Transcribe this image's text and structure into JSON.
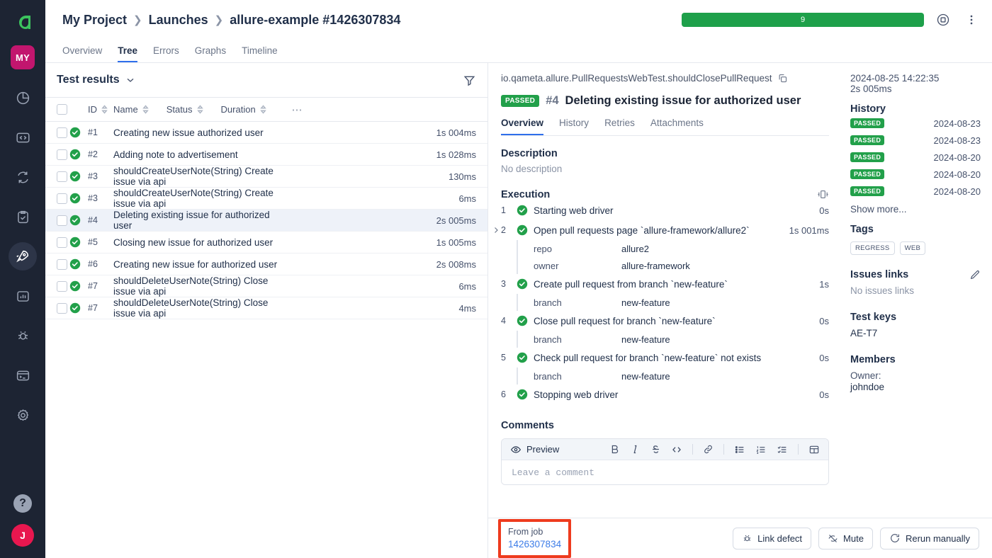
{
  "rail": {
    "logo": "allure-logo",
    "project_badge": "MY",
    "items": [
      {
        "icon": "pie-chart-icon",
        "name": "dashboards",
        "active": false
      },
      {
        "icon": "code-icon",
        "name": "code",
        "active": false
      },
      {
        "icon": "sync-icon",
        "name": "sync",
        "active": false
      },
      {
        "icon": "clipboard-check-icon",
        "name": "test-plan",
        "active": false
      },
      {
        "icon": "rocket-icon",
        "name": "launches",
        "active": true
      },
      {
        "icon": "bar-chart-icon",
        "name": "analytics",
        "active": false
      },
      {
        "icon": "bug-icon",
        "name": "defects",
        "active": false
      },
      {
        "icon": "terminal-icon",
        "name": "console",
        "active": false
      },
      {
        "icon": "gear-icon",
        "name": "settings",
        "active": false
      }
    ],
    "help": "?",
    "avatar": "J"
  },
  "header": {
    "breadcrumb": [
      "My Project",
      "Launches",
      "allure-example #1426307834"
    ],
    "progress_value": "9",
    "stop_icon": "stop-circle-icon",
    "menu_icon": "kebab-menu-icon"
  },
  "tabs": [
    {
      "label": "Overview",
      "active": false
    },
    {
      "label": "Tree",
      "active": true
    },
    {
      "label": "Errors",
      "active": false
    },
    {
      "label": "Graphs",
      "active": false
    },
    {
      "label": "Timeline",
      "active": false
    }
  ],
  "left_pane": {
    "title": "Test results",
    "filter_icon": "filter-icon",
    "columns": [
      "ID",
      "Name",
      "Status",
      "Duration"
    ],
    "more_icon": "ellipsis-icon",
    "rows": [
      {
        "id": "#1",
        "name": "Creating new issue authorized user",
        "status": "passed",
        "duration": "1s 004ms",
        "selected": false
      },
      {
        "id": "#2",
        "name": "Adding note to advertisement",
        "status": "passed",
        "duration": "1s 028ms",
        "selected": false
      },
      {
        "id": "#3",
        "name": "shouldCreateUserNote(String) Create issue via api",
        "status": "passed",
        "duration": "130ms",
        "selected": false
      },
      {
        "id": "#3",
        "name": "shouldCreateUserNote(String) Create issue via api",
        "status": "passed",
        "duration": "6ms",
        "selected": false
      },
      {
        "id": "#4",
        "name": "Deleting existing issue for authorized user",
        "status": "passed",
        "duration": "2s 005ms",
        "selected": true
      },
      {
        "id": "#5",
        "name": "Closing new issue for authorized user",
        "status": "passed",
        "duration": "1s 005ms",
        "selected": false
      },
      {
        "id": "#6",
        "name": "Creating new issue for authorized user",
        "status": "passed",
        "duration": "2s 008ms",
        "selected": false
      },
      {
        "id": "#7",
        "name": "shouldDeleteUserNote(String) Close issue via api",
        "status": "passed",
        "duration": "6ms",
        "selected": false
      },
      {
        "id": "#7",
        "name": "shouldDeleteUserNote(String) Close issue via api",
        "status": "passed",
        "duration": "4ms",
        "selected": false
      }
    ]
  },
  "detail": {
    "fqn": "io.qameta.allure.PullRequestsWebTest.shouldClosePullRequest",
    "copy_icon": "copy-icon",
    "status_badge": "PASSED",
    "test_number": "#4",
    "test_name": "Deleting existing issue for authorized user",
    "tabs": [
      {
        "label": "Overview",
        "active": true
      },
      {
        "label": "History",
        "active": false
      },
      {
        "label": "Retries",
        "active": false
      },
      {
        "label": "Attachments",
        "active": false
      }
    ],
    "description_heading": "Description",
    "description_value": "No description",
    "execution_heading": "Execution",
    "execution_icon": "expand-all-icon",
    "steps": [
      {
        "n": "1",
        "text": "Starting web driver",
        "duration": "0s",
        "expandable": false,
        "params": []
      },
      {
        "n": "2",
        "text": "Open pull requests page `allure-framework/allure2`",
        "duration": "1s 001ms",
        "expandable": true,
        "params": [
          {
            "k": "repo",
            "v": "allure2"
          },
          {
            "k": "owner",
            "v": "allure-framework"
          }
        ]
      },
      {
        "n": "3",
        "text": "Create pull request from branch `new-feature`",
        "duration": "1s",
        "expandable": false,
        "params": [
          {
            "k": "branch",
            "v": "new-feature"
          }
        ]
      },
      {
        "n": "4",
        "text": "Close pull request for branch `new-feature`",
        "duration": "0s",
        "expandable": false,
        "params": [
          {
            "k": "branch",
            "v": "new-feature"
          }
        ]
      },
      {
        "n": "5",
        "text": "Check pull request for branch `new-feature` not exists",
        "duration": "0s",
        "expandable": false,
        "params": [
          {
            "k": "branch",
            "v": "new-feature"
          }
        ]
      },
      {
        "n": "6",
        "text": "Stopping web driver",
        "duration": "0s",
        "expandable": false,
        "params": []
      }
    ],
    "comments_heading": "Comments",
    "editor": {
      "preview_label": "Preview",
      "preview_icon": "eye-icon",
      "placeholder": "Leave a comment",
      "tools": [
        "bold-icon",
        "italic-icon",
        "strikethrough-icon",
        "code-icon",
        "link-icon",
        "bulleted-list-icon",
        "numbered-list-icon",
        "checklist-icon",
        "table-icon"
      ]
    }
  },
  "meta": {
    "timestamp": "2024-08-25 14:22:35",
    "duration": "2s 005ms",
    "history_heading": "History",
    "history": [
      {
        "status": "PASSED",
        "date": "2024-08-23"
      },
      {
        "status": "PASSED",
        "date": "2024-08-23"
      },
      {
        "status": "PASSED",
        "date": "2024-08-20"
      },
      {
        "status": "PASSED",
        "date": "2024-08-20"
      },
      {
        "status": "PASSED",
        "date": "2024-08-20"
      }
    ],
    "show_more": "Show more...",
    "tags_heading": "Tags",
    "tags": [
      "REGRESS",
      "WEB"
    ],
    "issues_heading": "Issues links",
    "issues_edit_icon": "pencil-icon",
    "issues_value": "No issues links",
    "testkeys_heading": "Test keys",
    "testkeys_value": "AE-T7",
    "members_heading": "Members",
    "members_role": "Owner:",
    "members_value": "johndoe"
  },
  "actionbar": {
    "from_job_label": "From job",
    "from_job_value": "1426307834",
    "buttons": [
      {
        "label": "Link defect",
        "icon": "bug-icon"
      },
      {
        "label": "Mute",
        "icon": "eye-off-icon"
      },
      {
        "label": "Rerun manually",
        "icon": "rerun-icon"
      }
    ]
  },
  "colors": {
    "accent_blue": "#2f6feb",
    "pass_green": "#22a04a",
    "progress_green": "#1ea04a",
    "rail_bg": "#1d2433",
    "badge_magenta": "#c2166e",
    "avatar_red": "#e8174f",
    "highlight_red": "#ee3b1e",
    "link_blue": "#3d7de8"
  }
}
